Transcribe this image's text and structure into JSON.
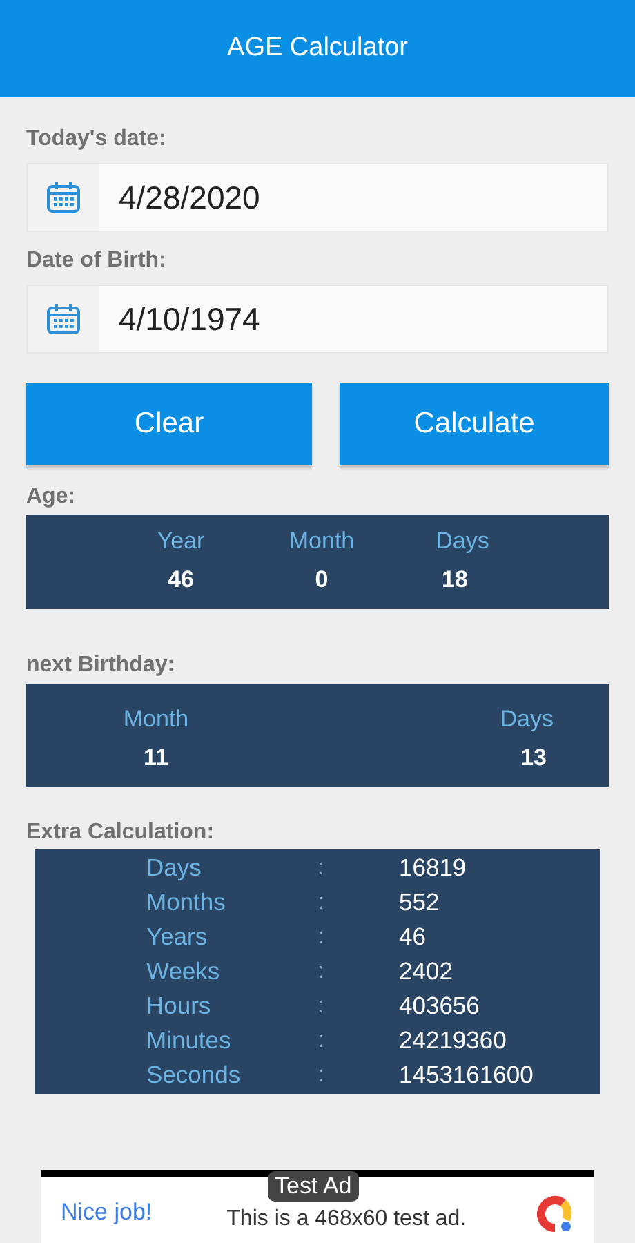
{
  "app_bar": {
    "title": "AGE Calculator"
  },
  "date_fields": [
    {
      "label": "Today's date:",
      "value": "4/28/2020"
    },
    {
      "label": "Date of Birth:",
      "value": "4/10/1974"
    }
  ],
  "buttons": [
    "Clear",
    "Calculate"
  ],
  "age": {
    "label": "Age:",
    "columns": [
      {
        "heading": "Year",
        "value": "46"
      },
      {
        "heading": "Month",
        "value": "0"
      },
      {
        "heading": "Days",
        "value": "18"
      }
    ]
  },
  "next_birthday": {
    "label": "next Birthday:",
    "columns": [
      {
        "heading": "Month",
        "value": "11"
      },
      {
        "heading": "Days",
        "value": "13"
      }
    ]
  },
  "extra": {
    "label": "Extra Calculation:",
    "rows": [
      {
        "name": "Days",
        "separator": ":",
        "value": "16819"
      },
      {
        "name": "Months",
        "separator": ":",
        "value": "552"
      },
      {
        "name": "Years",
        "separator": ":",
        "value": "46"
      },
      {
        "name": "Weeks",
        "separator": ":",
        "value": "2402"
      },
      {
        "name": "Hours",
        "separator": ":",
        "value": "403656"
      },
      {
        "name": "Minutes",
        "separator": ":",
        "value": "24219360"
      },
      {
        "name": "Seconds",
        "separator": ":",
        "value": "1453161600"
      }
    ]
  },
  "ad": {
    "badge": "Test Ad",
    "headline": "Nice job!",
    "text": "This is a 468x60 test ad."
  }
}
